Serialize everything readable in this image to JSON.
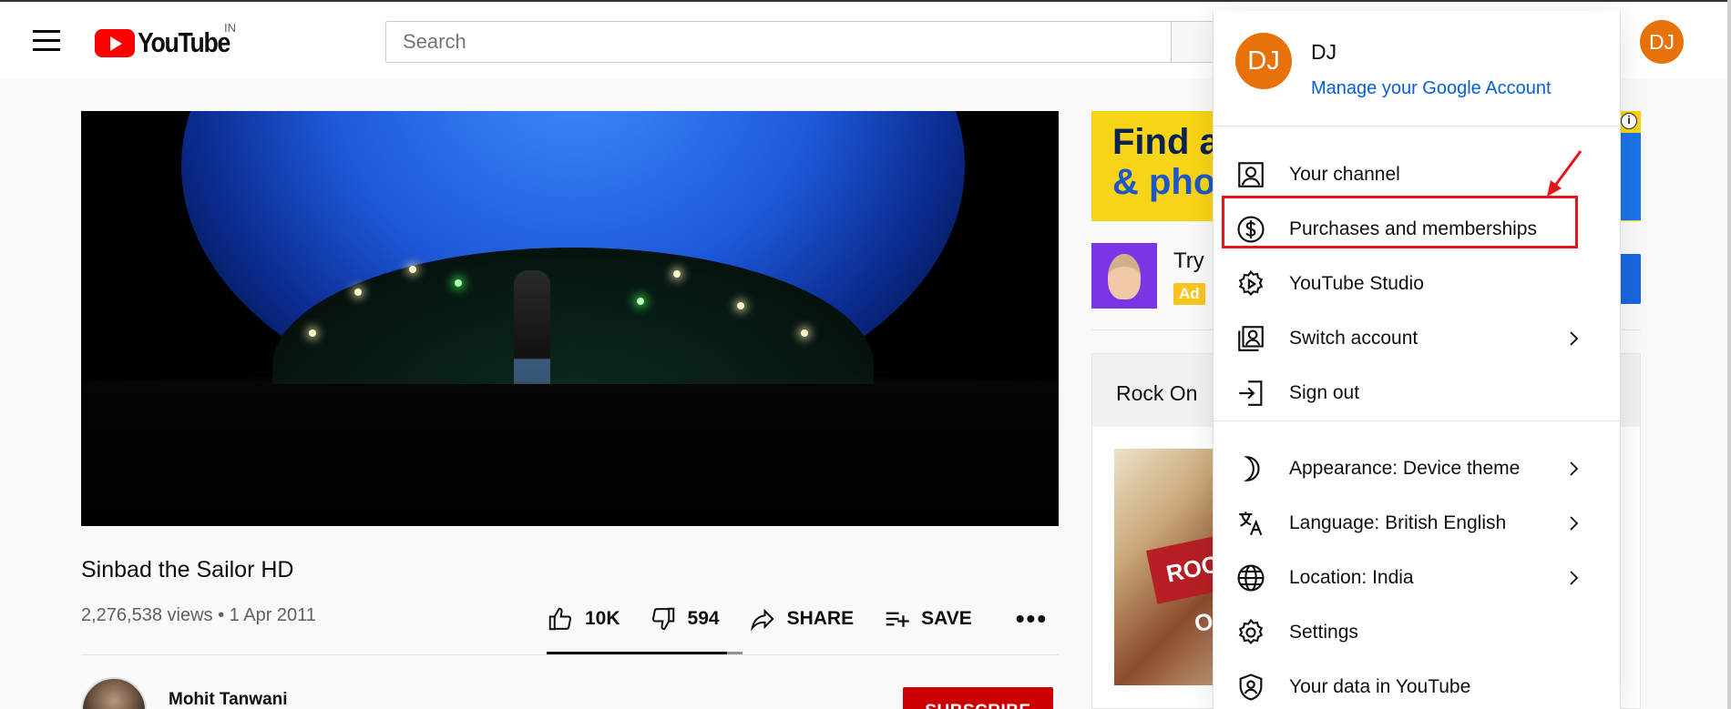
{
  "header": {
    "logo_text": "YouTube",
    "country_code": "IN",
    "search_placeholder": "Search",
    "avatar_initials": "DJ"
  },
  "video": {
    "title": "Sinbad the Sailor HD",
    "meta": "2,276,538 views • 1 Apr 2011",
    "likes": "10K",
    "dislikes": "594",
    "share_label": "SHARE",
    "save_label": "SAVE",
    "like_ratio": 0.92
  },
  "channel": {
    "name": "Mohit Tanwani",
    "subscribe_label": "SUBSCRIBE"
  },
  "sidebar": {
    "ad_banner_line1": "Find a",
    "ad_banner_line2": "& pho",
    "ad_try": "Try",
    "ad_badge": "Ad",
    "playlist_title": "Rock On",
    "poster_text": "ROCK ON"
  },
  "menu": {
    "avatar_initials": "DJ",
    "user_name": "DJ",
    "manage_account": "Manage your Google Account",
    "items_top": [
      {
        "label": "Your channel",
        "icon": "person-icon"
      },
      {
        "label": "Purchases and memberships",
        "icon": "dollar-icon"
      },
      {
        "label": "YouTube Studio",
        "icon": "studio-gear-icon"
      },
      {
        "label": "Switch account",
        "icon": "switch-account-icon"
      },
      {
        "label": "Sign out",
        "icon": "sign-out-icon"
      }
    ],
    "items_bottom": [
      {
        "label": "Appearance: Device theme",
        "icon": "moon-icon"
      },
      {
        "label": "Language: British English",
        "icon": "translate-icon"
      },
      {
        "label": "Location: India",
        "icon": "globe-icon"
      },
      {
        "label": "Settings",
        "icon": "gear-icon"
      },
      {
        "label": "Your data in YouTube",
        "icon": "shield-person-icon"
      }
    ]
  },
  "annotation": {
    "highlight_color": "#e4141b"
  }
}
